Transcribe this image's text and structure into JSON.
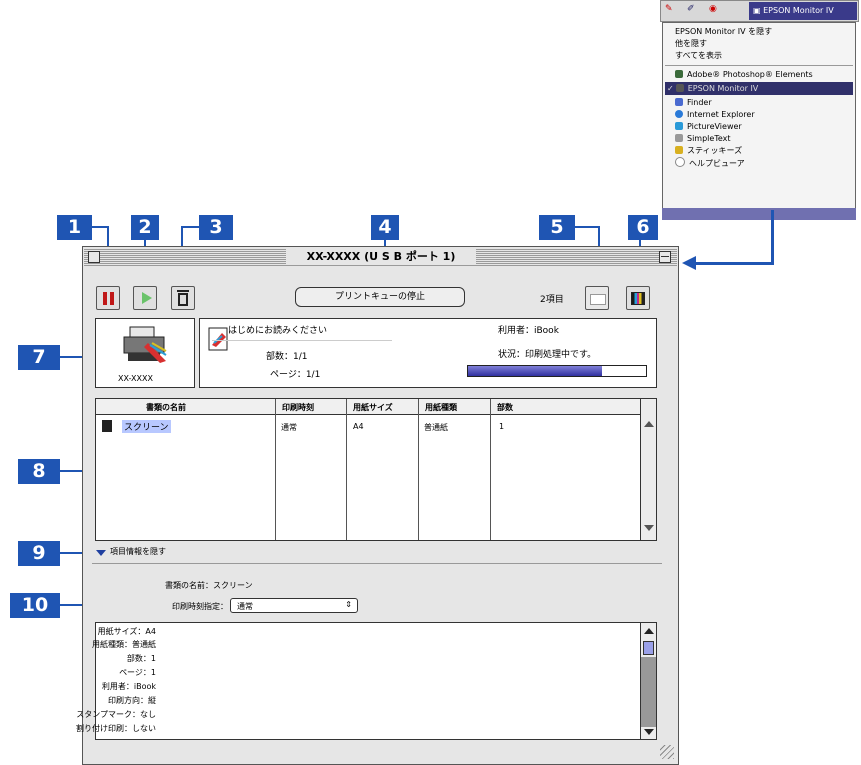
{
  "menubar": {
    "monitor_label": "EPSON Monitor IV"
  },
  "menu": {
    "items": [
      "EPSON Monitor IV を隠す",
      "他を隠す",
      "すべてを表示",
      "Adobe® Photoshop® Elements",
      "EPSON Monitor IV",
      "Finder",
      "Internet Explorer",
      "PictureViewer",
      "SimpleText",
      "スティッキーズ",
      "ヘルプビューア"
    ]
  },
  "badges": [
    "1",
    "2",
    "3",
    "4",
    "5",
    "6",
    "7",
    "8",
    "9",
    "10"
  ],
  "window": {
    "title": "XX-XXXX (U S B ポート 1)",
    "stop_queue_label": "プリントキューの停止",
    "count": "2項目",
    "printer_name": "XX-XXXX"
  },
  "current_job": {
    "name": "はじめにお読みください",
    "copies": "部数：1/1",
    "pages": "ページ：1/1",
    "user": "利用者：iBook",
    "status": "状況：印刷処理中です。",
    "progress": 0.75
  },
  "list": {
    "headers": [
      "書類の名前",
      "印刷時刻",
      "用紙サイズ",
      "用紙種類",
      "部数"
    ],
    "rows": [
      {
        "name": "スクリーン",
        "time": "通常",
        "size": "A4",
        "type": "普通紙",
        "copies": "1"
      }
    ]
  },
  "details": {
    "toggle_label": "項目情報を隠す",
    "doc_name": "書類の名前：スクリーン",
    "print_time_label": "印刷時刻指定：",
    "print_time_value": "通常",
    "lines": [
      "用紙サイズ：A4",
      "用紙種類：普通紙",
      "部数：1",
      "ページ：1",
      "利用者：iBook",
      "印刷方向：縦",
      "スタンプマーク：なし",
      "割り付け印刷：しない"
    ]
  }
}
